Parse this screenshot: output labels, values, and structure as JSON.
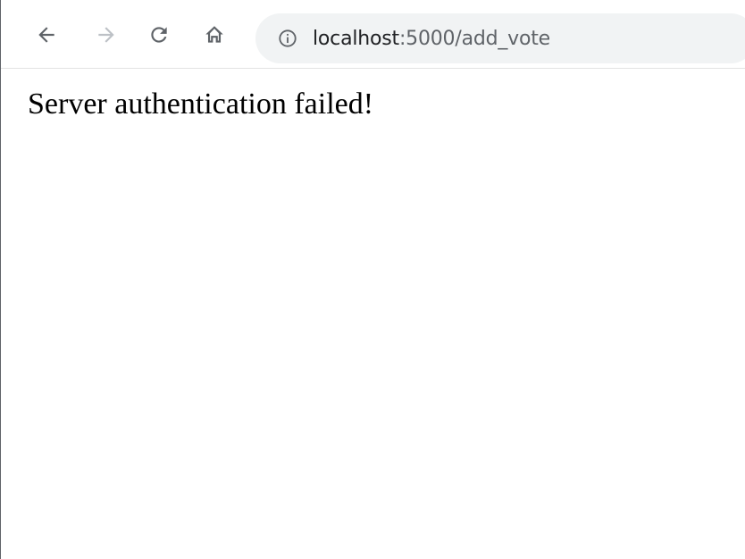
{
  "browser": {
    "toolbar": {
      "back_icon": "back-arrow-icon",
      "forward_icon": "forward-arrow-icon",
      "reload_icon": "reload-icon",
      "home_icon": "home-icon"
    },
    "address_bar": {
      "icon": "info-icon",
      "host": "localhost",
      "path": ":5000/add_vote"
    },
    "colors": {
      "icon_active": "#5f6368",
      "icon_disabled": "#bdc1c6",
      "omnibox_bg": "#f1f3f4"
    }
  },
  "page": {
    "message": "Server authentication failed!"
  }
}
